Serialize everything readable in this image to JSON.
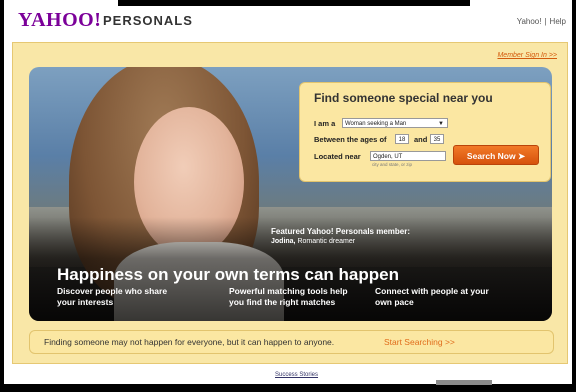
{
  "header": {
    "logo": "YAHOO!",
    "logo_sub": "PERSONALS",
    "links": [
      "Yahoo!",
      "Help"
    ]
  },
  "frame": {
    "member_sign_in": "Member Sign In >>"
  },
  "search": {
    "title": "Find someone special near you",
    "i_am_label": "I am a",
    "i_am_value": "Woman seeking a Man",
    "ages_label": "Between the ages of",
    "age_min": "18",
    "and_label": "and",
    "age_max": "35",
    "located_label": "Located near",
    "location_value": "Ogden, UT",
    "location_hint": "city and state, or zip",
    "button": "Search Now ➤"
  },
  "featured": {
    "title": "Featured Yahoo! Personals member:",
    "name": "Jodina,",
    "description": "Romantic dreamer"
  },
  "hero": {
    "headline": "Happiness on your own terms can happen",
    "features": [
      "Discover people who share\nyour interests",
      "Powerful matching tools help\nyou find the right matches",
      "Connect with people at your\nown pace"
    ]
  },
  "bottom": {
    "text": "Finding someone may not happen for everyone, but it can happen to anyone.",
    "link": "Start Searching >>"
  },
  "footer": {
    "success": "Success Stories"
  },
  "colors": {
    "brand": "#7b0099",
    "accent": "#e06c1b",
    "panel": "#f9e7a7"
  }
}
